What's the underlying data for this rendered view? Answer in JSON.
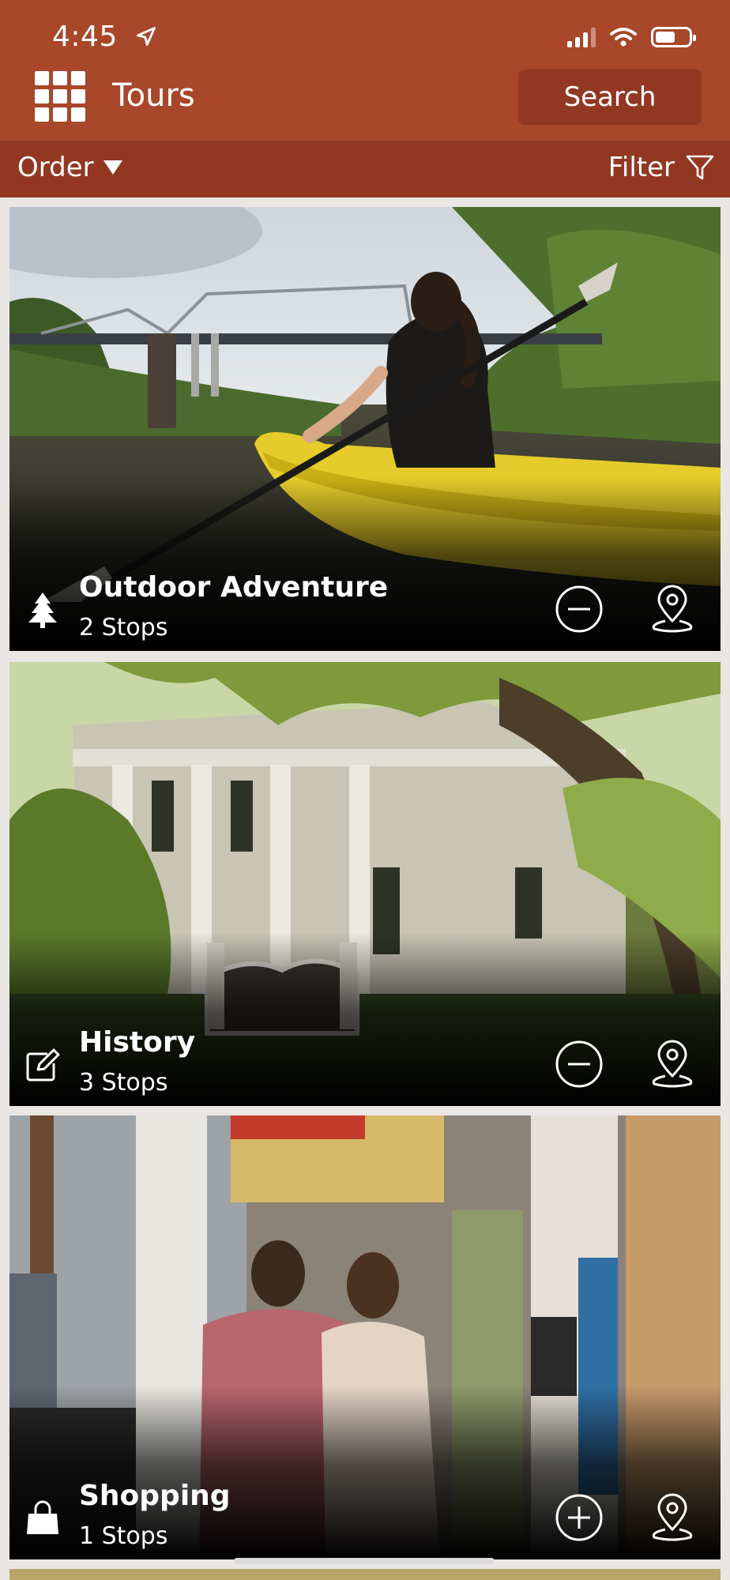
{
  "status_bar": {
    "time": "4:45"
  },
  "header": {
    "title": "Tours",
    "search_label": "Search"
  },
  "toolbar": {
    "order_label": "Order",
    "filter_label": "Filter"
  },
  "colors": {
    "header_bg": "#a8472a",
    "subbar_bg": "#923822",
    "search_bg": "#923822"
  },
  "tours": [
    {
      "name": "Outdoor Adventure",
      "stops": "2 Stops",
      "category_icon": "tree-icon",
      "action_icon": "minus-circle-icon",
      "map_icon": "map-pin-icon"
    },
    {
      "name": "History",
      "stops": "3 Stops",
      "category_icon": "edit-icon",
      "action_icon": "minus-circle-icon",
      "map_icon": "map-pin-icon"
    },
    {
      "name": "Shopping",
      "stops": "1 Stops",
      "category_icon": "shopping-bag-icon",
      "action_icon": "plus-circle-icon",
      "map_icon": "map-pin-icon"
    }
  ]
}
